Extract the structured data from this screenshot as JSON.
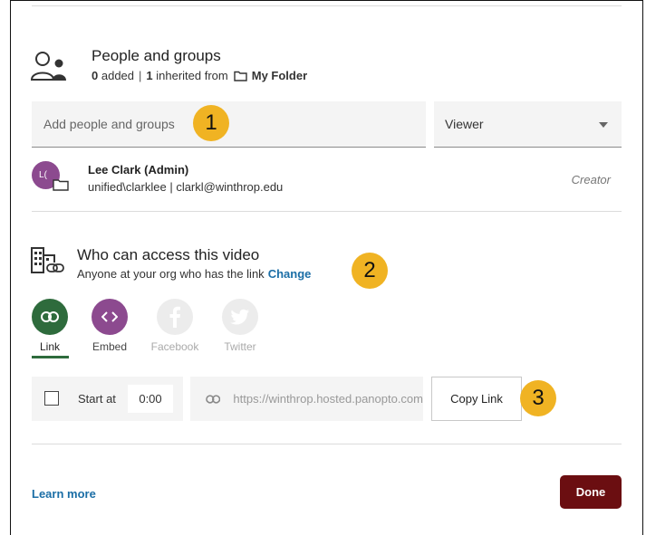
{
  "people_groups": {
    "title": "People and groups",
    "added_count": "0",
    "added_label": "added",
    "separator": "|",
    "inherited_count": "1",
    "inherited_label": "inherited from",
    "folder_name": "My Folder",
    "input_placeholder": "Add people and groups",
    "role_selected": "Viewer"
  },
  "user": {
    "initials": "L(",
    "name": "Lee Clark (Admin)",
    "detail": "unified\\clarklee | clarkl@winthrop.edu",
    "role": "Creator"
  },
  "access": {
    "title": "Who can access this video",
    "subtitle": "Anyone at your org who has the link",
    "change_label": "Change"
  },
  "share_options": [
    {
      "label": "Link",
      "color": "#2e6b3c"
    },
    {
      "label": "Embed",
      "color": "#8c4a8f"
    },
    {
      "label": "Facebook",
      "color": "#ececec"
    },
    {
      "label": "Twitter",
      "color": "#ececec"
    }
  ],
  "start_at": {
    "label": "Start at",
    "time": "0:00"
  },
  "link": {
    "url": "https://winthrop.hosted.panopto.com",
    "copy_label": "Copy Link"
  },
  "footer": {
    "learn_more": "Learn more",
    "done": "Done"
  },
  "badges": [
    "1",
    "2",
    "3"
  ],
  "colors": {
    "accent_link": "#1b6ea6",
    "done_button": "#6b0e11",
    "badge": "#f0b323"
  }
}
